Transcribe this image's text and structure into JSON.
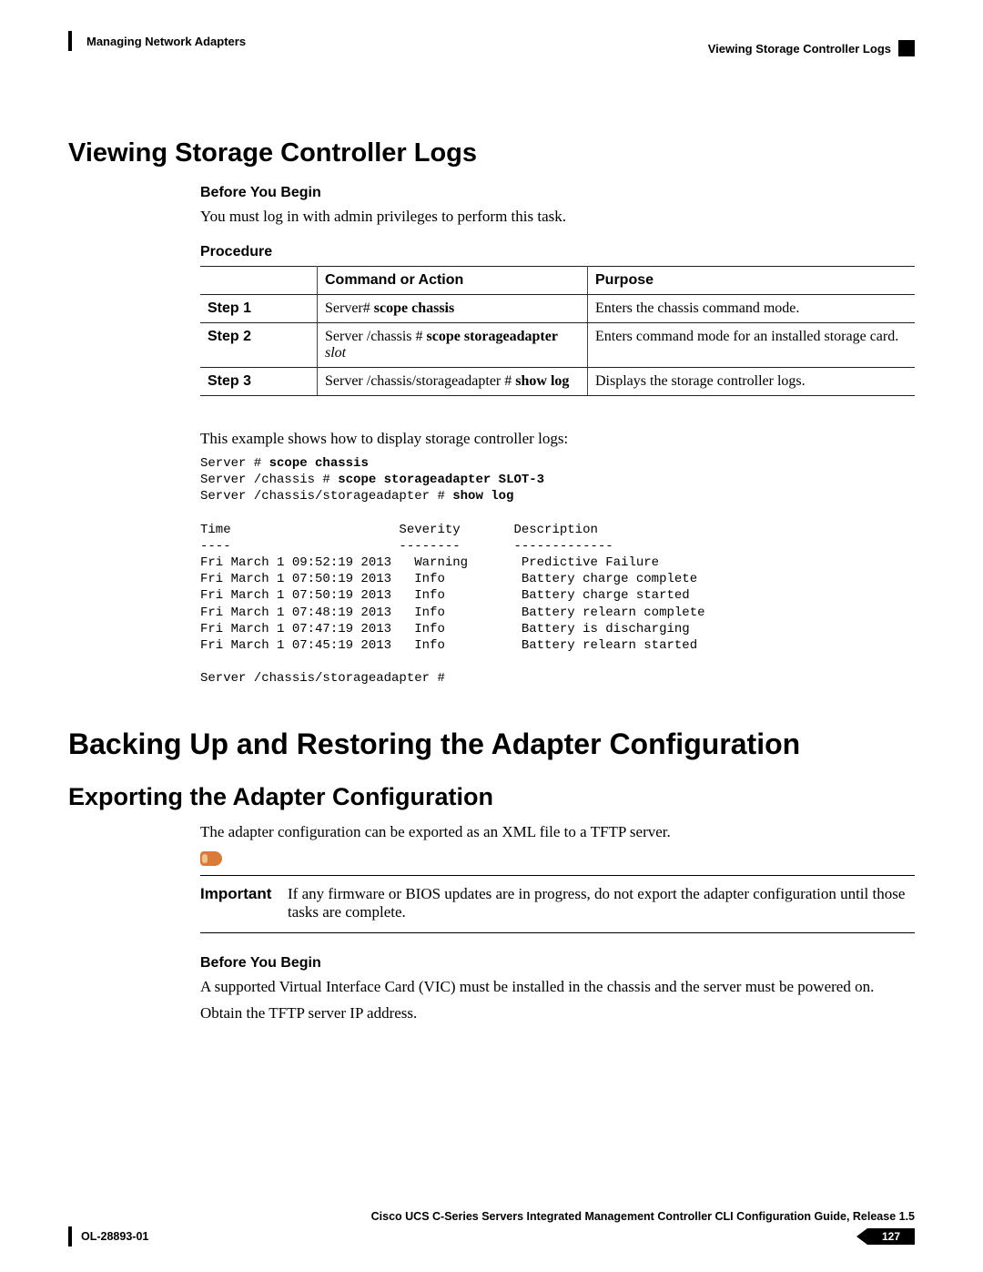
{
  "header": {
    "left": "Managing Network Adapters",
    "right": "Viewing Storage Controller Logs"
  },
  "h1": "Viewing Storage Controller Logs",
  "before_begin": {
    "heading": "Before You Begin",
    "text": "You must log in with admin privileges to perform this task."
  },
  "procedure_heading": "Procedure",
  "table": {
    "head_step": "",
    "head_cmd": "Command or Action",
    "head_purpose": "Purpose",
    "rows": [
      {
        "step": "Step 1",
        "cmd_prefix": "Server# ",
        "cmd_bold": "scope chassis",
        "cmd_italic": "",
        "purpose": "Enters the chassis command mode."
      },
      {
        "step": "Step 2",
        "cmd_prefix": "Server /chassis # ",
        "cmd_bold": "scope storageadapter ",
        "cmd_italic": "slot",
        "purpose": "Enters command mode for an installed storage card."
      },
      {
        "step": "Step 3",
        "cmd_prefix": "Server /chassis/storageadapter # ",
        "cmd_bold": "show log",
        "cmd_italic": "",
        "purpose": "Displays the storage controller logs."
      }
    ]
  },
  "example_intro": "This example shows how to display storage controller logs:",
  "cli": {
    "l1a": "Server # ",
    "l1b": "scope chassis",
    "l2a": "Server /chassis # ",
    "l2b": "scope storageadapter SLOT-3",
    "l3a": "Server /chassis/storageadapter # ",
    "l3b": "show log",
    "hdr": "Time                      Severity       Description",
    "sep": "----                      --------       -------------",
    "r1": "Fri March 1 09:52:19 2013   Warning       Predictive Failure",
    "r2": "Fri March 1 07:50:19 2013   Info          Battery charge complete",
    "r3": "Fri March 1 07:50:19 2013   Info          Battery charge started",
    "r4": "Fri March 1 07:48:19 2013   Info          Battery relearn complete",
    "r5": "Fri March 1 07:47:19 2013   Info          Battery is discharging",
    "r6": "Fri March 1 07:45:19 2013   Info          Battery relearn started",
    "tail": "Server /chassis/storageadapter #"
  },
  "h2_backup": "Backing Up and Restoring the Adapter Configuration",
  "h2_export": "Exporting the Adapter Configuration",
  "export_intro": "The adapter configuration can be exported as an XML file to a TFTP server.",
  "note": {
    "label": "Important",
    "text": "If any firmware or BIOS updates are in progress, do not export the adapter configuration until those tasks are complete."
  },
  "before_begin2": {
    "heading": "Before You Begin",
    "line1": "A supported Virtual Interface Card (VIC) must be installed in the chassis and the server must be powered on.",
    "line2": "Obtain the TFTP server IP address."
  },
  "footer": {
    "guide": "Cisco UCS C-Series Servers Integrated Management Controller CLI Configuration Guide, Release 1.5",
    "docid": "OL-28893-01",
    "page": "127"
  }
}
